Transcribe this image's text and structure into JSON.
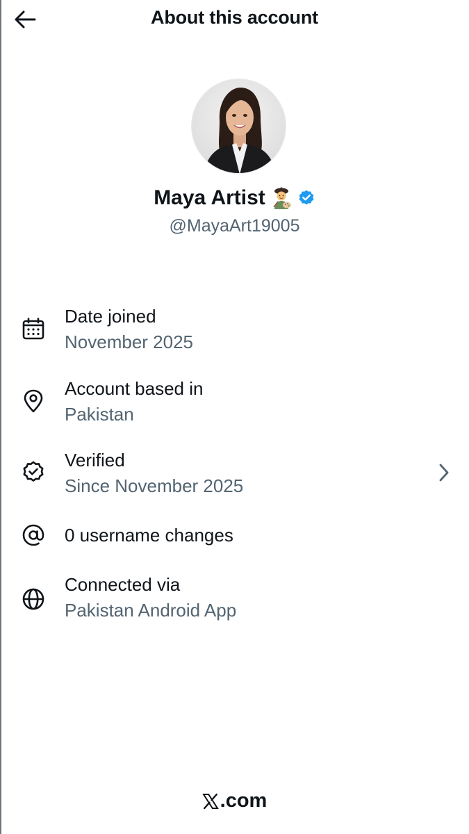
{
  "header": {
    "title": "About this account",
    "back_icon": "arrow-left-icon"
  },
  "profile": {
    "display_name": "Maya Artist",
    "name_emoji": "🧑‍🎨",
    "verified_badge_color": "#1d9bf0",
    "handle": "@MayaArt19005"
  },
  "details": {
    "date_joined": {
      "icon": "calendar-icon",
      "title": "Date joined",
      "value": "November 2025"
    },
    "account_based_in": {
      "icon": "location-pin-icon",
      "title": "Account based in",
      "value": "Pakistan"
    },
    "verified": {
      "icon": "verified-badge-outline-icon",
      "title": "Verified",
      "value": "Since November 2025",
      "chevron_icon": "chevron-right-icon"
    },
    "username_changes": {
      "icon": "at-sign-icon",
      "title": "0 username changes"
    },
    "connected_via": {
      "icon": "globe-icon",
      "title": "Connected via",
      "value": "Pakistan Android App"
    }
  },
  "footer": {
    "brand_text": ".com",
    "brand_logo": "x-logo-icon"
  },
  "colors": {
    "text_primary": "#0f1419",
    "text_secondary": "#536471",
    "accent": "#1d9bf0"
  }
}
